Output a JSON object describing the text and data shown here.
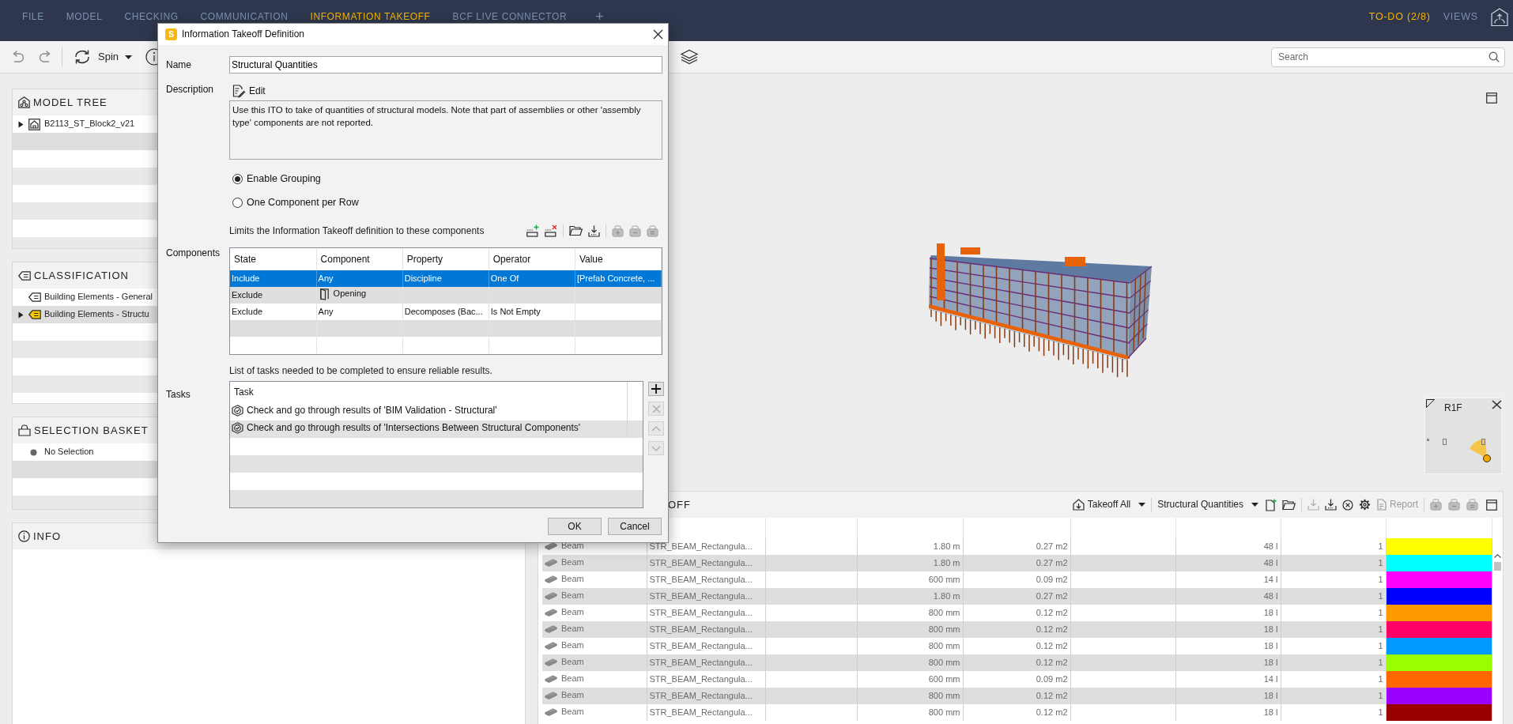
{
  "menu_bar": {
    "tabs": [
      {
        "label": "FILE",
        "selected": false
      },
      {
        "label": "MODEL",
        "selected": false
      },
      {
        "label": "CHECKING",
        "selected": false
      },
      {
        "label": "COMMUNICATION",
        "selected": false
      },
      {
        "label": "INFORMATION TAKEOFF",
        "selected": true
      },
      {
        "label": "BCF LIVE CONNECTOR",
        "selected": false
      }
    ],
    "add_tab": "+",
    "right_items": [
      {
        "label": "TO-DO (2/8)",
        "selected": true
      },
      {
        "label": "VIEWS",
        "selected": false
      }
    ]
  },
  "toolbar": {
    "spin": "Spin",
    "search": {
      "placeholder": "Search"
    }
  },
  "panels": [
    {
      "kind": "tree",
      "title": "MODEL TREE",
      "items": [
        {
          "label": "B2113_ST_Block2_v21",
          "expanded": false
        }
      ]
    },
    {
      "kind": "classification",
      "title": "CLASSIFICATION",
      "items": [
        {
          "label": "Building Elements - General",
          "active": false
        },
        {
          "label": "Building Elements - Structu",
          "active": true,
          "expanded": false
        }
      ]
    },
    {
      "kind": "basket",
      "title": "SELECTION BASKET",
      "items": [
        {
          "label": "No Selection"
        }
      ]
    },
    {
      "kind": "info",
      "title": "INFO"
    }
  ],
  "viewport": {
    "nav_cube": {
      "label": "R1F"
    }
  },
  "takeoff": {
    "title": "OFF",
    "takeoff_menu": "Takeoff All",
    "definition_menu": "Structural Quantities",
    "tools_left": [
      {
        "disabled": false
      },
      {
        "disabled": false
      },
      {
        "disabled": true
      },
      {
        "disabled": false
      },
      {
        "disabled": false
      },
      {
        "disabled": false
      }
    ],
    "report": {
      "label": "Report",
      "disabled": true
    },
    "tools_right": [
      {
        "disabled": true
      },
      {
        "disabled": true
      },
      {
        "disabled": true
      }
    ],
    "rows": [
      {
        "column_1": "Beam",
        "column_2": "STR_BEAM_Rectangula...",
        "column_4": "1.80 m",
        "column_5": "0.27 m2",
        "column_7": "48 l",
        "column_8": "1",
        "color": "#ffff00"
      },
      {
        "column_1": "Beam",
        "column_2": "STR_BEAM_Rectangula...",
        "column_4": "1.80 m",
        "column_5": "0.27 m2",
        "column_7": "48 l",
        "column_8": "1",
        "color": "#00ffff"
      },
      {
        "column_1": "Beam",
        "column_2": "STR_BEAM_Rectangula...",
        "column_4": "600 mm",
        "column_5": "0.09 m2",
        "column_7": "14 l",
        "column_8": "1",
        "color": "#ff00ff"
      },
      {
        "column_1": "Beam",
        "column_2": "STR_BEAM_Rectangula...",
        "column_4": "1.80 m",
        "column_5": "0.27 m2",
        "column_7": "48 l",
        "column_8": "1",
        "color": "#0000ff"
      },
      {
        "column_1": "Beam",
        "column_2": "STR_BEAM_Rectangula...",
        "column_4": "800 mm",
        "column_5": "0.12 m2",
        "column_7": "18 l",
        "column_8": "1",
        "color": "#ff9900"
      },
      {
        "column_1": "Beam",
        "column_2": "STR_BEAM_Rectangula...",
        "column_4": "800 mm",
        "column_5": "0.12 m2",
        "column_7": "18 l",
        "column_8": "1",
        "color": "#ff0066"
      },
      {
        "column_1": "Beam",
        "column_2": "STR_BEAM_Rectangula...",
        "column_4": "800 mm",
        "column_5": "0.12 m2",
        "column_7": "18 l",
        "column_8": "1",
        "color": "#0099ff"
      },
      {
        "column_1": "Beam",
        "column_2": "STR_BEAM_Rectangula...",
        "column_4": "800 mm",
        "column_5": "0.12 m2",
        "column_7": "18 l",
        "column_8": "1",
        "color": "#99ff00"
      },
      {
        "column_1": "Beam",
        "column_2": "STR_BEAM_Rectangula...",
        "column_4": "600 mm",
        "column_5": "0.09 m2",
        "column_7": "14 l",
        "column_8": "1",
        "color": "#ff6600"
      },
      {
        "column_1": "Beam",
        "column_2": "STR_BEAM_Rectangula...",
        "column_4": "800 mm",
        "column_5": "0.12 m2",
        "column_7": "18 l",
        "column_8": "1",
        "color": "#9900ff"
      },
      {
        "column_1": "Beam",
        "column_2": "STR_BEAM_Rectangula...",
        "column_4": "800 mm",
        "column_5": "0.12 m2",
        "column_7": "18 l",
        "column_8": "1",
        "color": "#990000"
      }
    ]
  },
  "dialog": {
    "icon_text": "S",
    "title": "Information Takeoff Definition",
    "name_label": "Name",
    "name_value": "Structural Quantities",
    "description_label": "Description",
    "edit_button": "Edit",
    "description": "Use this ITO to take of quantities of structural models. Note that part of assemblies or other 'assembly type' components are not reported.",
    "grouping": [
      {
        "label": "Enable Grouping",
        "selected": true
      },
      {
        "label": "One Component per Row",
        "selected": false
      }
    ],
    "components_caption": "Limits the Information Takeoff definition to these components",
    "component_tools": [
      {
        "disabled": false
      },
      {
        "disabled": false
      },
      {
        "disabled": false
      },
      {
        "disabled": false
      },
      {
        "disabled": true
      },
      {
        "disabled": true
      },
      {
        "disabled": true
      }
    ],
    "components_label": "Components",
    "component_columns": [
      "State",
      "Component",
      "Property",
      "Operator",
      "Value"
    ],
    "component_rows": [
      {
        "kind": "any",
        "state": "Include",
        "component": "Any",
        "property": "Discipline",
        "operator": "One Of",
        "value": "[Prefab Concrete, ...",
        "selected": true
      },
      {
        "kind": "type",
        "state": "Exclude",
        "component": "Opening",
        "selected": false
      },
      {
        "kind": "any",
        "state": "Exclude",
        "component": "Any",
        "property": "Decomposes (Bac...",
        "operator": "Is Not Empty",
        "selected": false
      }
    ],
    "tasks_caption": "List of tasks needed to be completed to ensure reliable results.",
    "tasks_label": "Tasks",
    "task_column": "Task",
    "tasks": [
      "Check and go through results of 'BIM Validation - Structural'",
      "Check and go through results of 'Intersections Between Structural Components'"
    ],
    "task_buttons": [
      {
        "disabled": false
      },
      {
        "disabled": true
      },
      {
        "disabled": true
      },
      {
        "disabled": true
      }
    ],
    "buttons": [
      "OK",
      "Cancel"
    ]
  }
}
